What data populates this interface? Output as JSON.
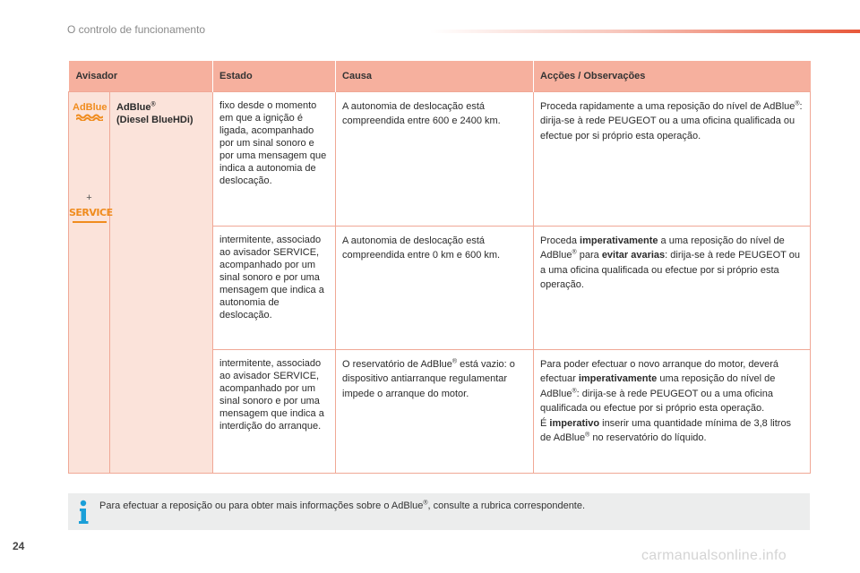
{
  "header": {
    "section_title": "O controlo de funcionamento",
    "accent_color": "#e8583a"
  },
  "table": {
    "columns": [
      "Avisador",
      "Estado",
      "Causa",
      "Acções / Observações"
    ],
    "warning_lamp": {
      "icon_top_label": "AdBlue",
      "icon_plus": "+",
      "icon_bottom_label": "SERVICE",
      "name": "AdBlue",
      "name_suffix": "(Diesel BlueHDi)"
    },
    "rows": [
      {
        "estado": "fixo desde o momento em que a ignição é ligada, acompanhado por um sinal sonoro e por uma mensagem que indica a autonomia de deslocação.",
        "causa": "A autonomia de deslocação está compreendida entre 600 e 2400 km.",
        "accao": {
          "t1": "Proceda rapidamente a uma reposição do nível de AdBlue",
          "t2": ": dirija-se à rede PEUGEOT ou a uma oficina qualificada ou efectue por si próprio esta operação."
        }
      },
      {
        "estado": "intermitente, associado ao avisador SERVICE, acompanhado por um sinal sonoro e por uma mensagem que indica a autonomia de deslocação.",
        "causa": "A autonomia de deslocação está compreendida entre 0 km e 600 km.",
        "accao": {
          "t1": "Proceda ",
          "b1": "imperativamente",
          "t2": " a uma reposição do nível de AdBlue",
          "t3": " para ",
          "b2": "evitar avarias",
          "t4": ": dirija-se à rede PEUGEOT ou a uma oficina qualificada ou efectue por si próprio esta operação."
        }
      },
      {
        "estado": "intermitente, associado ao avisador SERVICE, acompanhado por um sinal sonoro e por uma mensagem que indica a interdição do arranque.",
        "causa": {
          "t1": "O reservatório de AdBlue",
          "t2": " está vazio: o dispositivo antiarranque regulamentar impede o arranque do motor."
        },
        "accao": {
          "t1": "Para poder efectuar o novo arranque do motor, deverá efectuar ",
          "b1": "imperativamente",
          "t2": " uma reposição do nível de AdBlue",
          "t3": ": dirija-se à rede PEUGEOT ou a uma oficina qualificada ou efectue por si próprio esta operação.",
          "t4": "É ",
          "b2": "imperativo",
          "t5": " inserir uma quantidade mínima de 3,8 litros de AdBlue",
          "t6": " no reservatório do líquido."
        }
      }
    ],
    "registered_mark": "®",
    "header_color": "#f6b09e",
    "icon_cell_color": "#fbe3da",
    "icon_color": "#f08c1e"
  },
  "info": {
    "text1": "Para efectuar a reposição ou para obter mais informações sobre o AdBlue",
    "text2": ", consulte a rubrica correspondente.",
    "icon": "info-icon"
  },
  "footer": {
    "page_number": "24",
    "watermark": "carmanualsonline.info"
  }
}
